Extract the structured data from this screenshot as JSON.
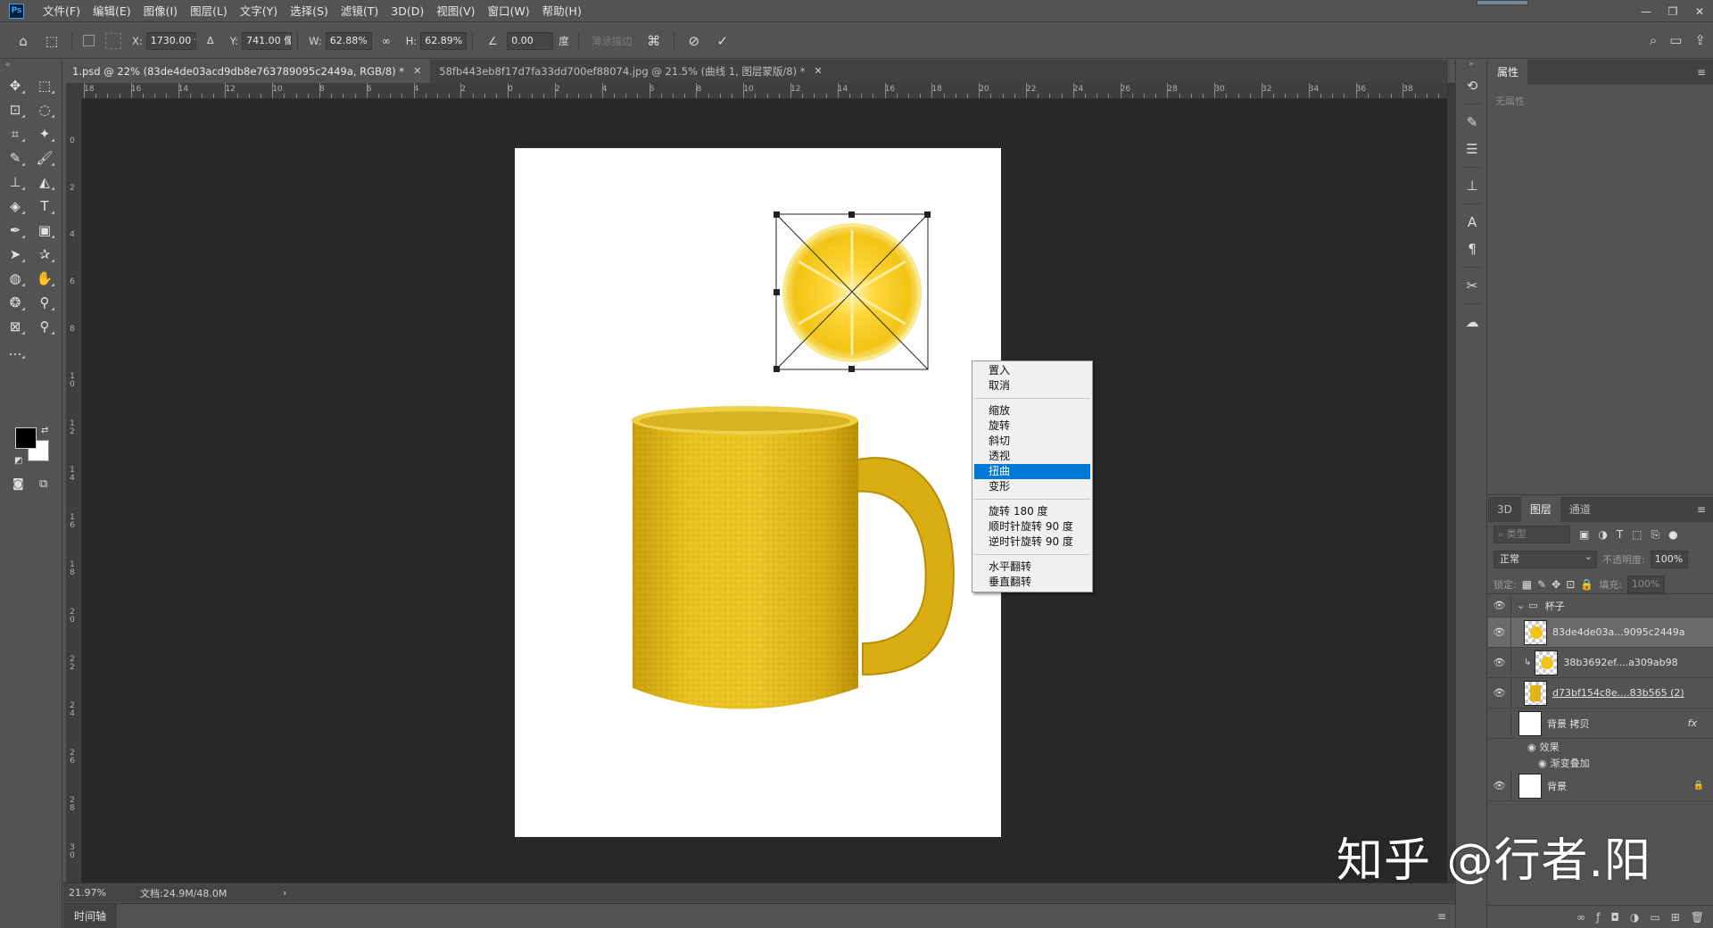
{
  "app": {
    "logo": "Ps"
  },
  "menu": [
    "文件(F)",
    "编辑(E)",
    "图像(I)",
    "图层(L)",
    "文字(Y)",
    "选择(S)",
    "滤镜(T)",
    "3D(D)",
    "视图(V)",
    "窗口(W)",
    "帮助(H)"
  ],
  "window_controls": {
    "minimize": "—",
    "restore": "❐",
    "close": "✕"
  },
  "options": {
    "x_label": "X:",
    "x_value": "1730.00 像",
    "y_label": "Y:",
    "y_value": "741.00 像",
    "w_label": "W:",
    "w_value": "62.88%",
    "h_label": "H:",
    "h_value": "62.89%",
    "angle_value": "0.00",
    "angle_unit": "度",
    "disabled_label": "薄涂描边"
  },
  "doc_tabs": [
    {
      "label": "1.psd @ 22% (83de4de03acd9db8e763789095c2449a, RGB/8) *",
      "active": true
    },
    {
      "label": "58fb443eb8f17d7fa33dd700ef88074.jpg @ 21.5% (曲线 1, 图层蒙版/8) *",
      "active": false
    }
  ],
  "ruler_h": [
    "18",
    "16",
    "14",
    "12",
    "10",
    "8",
    "6",
    "4",
    "2",
    "0",
    "2",
    "4",
    "6",
    "8",
    "10",
    "12",
    "14",
    "16",
    "18",
    "20",
    "22",
    "24",
    "26",
    "28",
    "30",
    "32",
    "34",
    "36",
    "38"
  ],
  "ruler_v": [
    "2",
    "0",
    "2",
    "4",
    "6",
    "8",
    "10",
    "12",
    "14",
    "16",
    "18",
    "20",
    "22",
    "24",
    "26",
    "28",
    "30"
  ],
  "context_menu": {
    "group1": [
      "置入",
      "取消"
    ],
    "group2": [
      "缩放",
      "旋转",
      "斜切",
      "透视",
      "扭曲",
      "变形"
    ],
    "highlighted": "扭曲",
    "group3": [
      "旋转 180 度",
      "顺时针旋转 90 度",
      "逆时针旋转 90 度"
    ],
    "group4": [
      "水平翻转",
      "垂直翻转"
    ]
  },
  "status": {
    "zoom": "21.97%",
    "doc_info": "文档:24.9M/48.0M",
    "arrow": "›"
  },
  "timeline": {
    "label": "时间轴"
  },
  "properties": {
    "title": "属性",
    "empty_text": "无属性"
  },
  "layers_panel": {
    "tabs": [
      "3D",
      "图层",
      "通道"
    ],
    "active_tab": "图层",
    "search_placeholder": "类型",
    "blend_mode": "正常",
    "opacity_label": "不透明度:",
    "opacity_value": "100%",
    "lock_label": "锁定:",
    "fill_label": "填充:",
    "fill_value": "100%",
    "group_name": "杯子",
    "layers": [
      {
        "name": "83de4de03a...9095c2449a",
        "selected": true
      },
      {
        "name": "38b3692ef....a309ab98",
        "selected": false
      },
      {
        "name": "d73bf154c8e....83b565 (2)",
        "selected": false
      },
      {
        "name": "背景 拷贝",
        "selected": false
      },
      {
        "name": "背景",
        "selected": false
      }
    ],
    "effects_label": "效果",
    "effect_name": "渐变叠加",
    "fx": "fx"
  },
  "watermark": "知乎 @行者.阳"
}
